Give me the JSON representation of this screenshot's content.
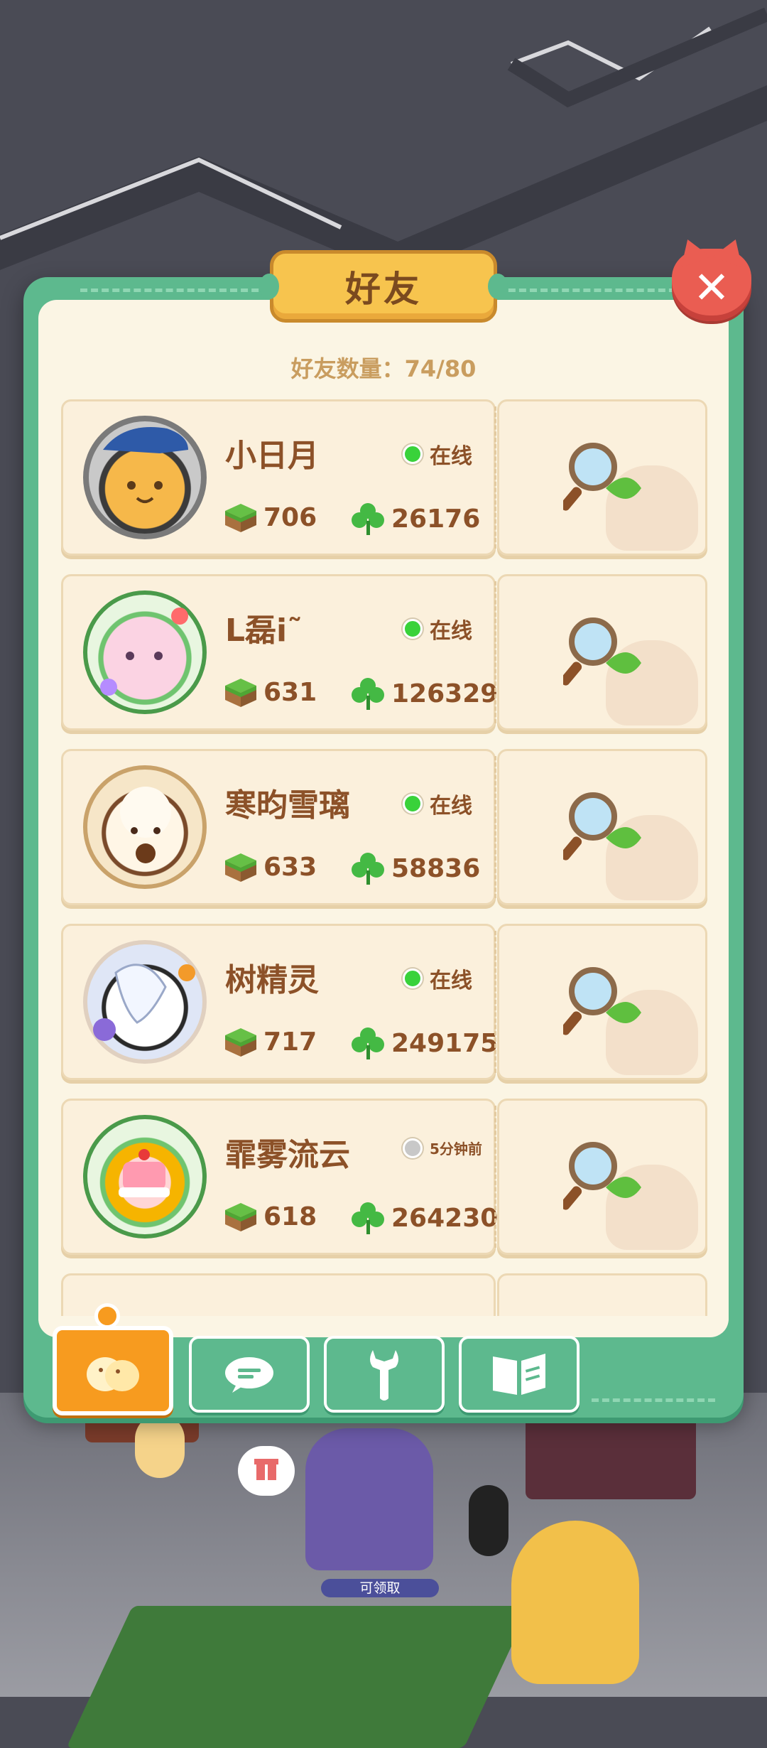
{
  "title": "好友",
  "friend_count_text": "好友数量：74/80",
  "close_label": "✕",
  "friends": [
    {
      "name": "小日月",
      "status": "在线",
      "online": true,
      "grass": "706",
      "clover": "26176"
    },
    {
      "name": "L磊i˜",
      "status": "在线",
      "online": true,
      "grass": "631",
      "clover": "126329"
    },
    {
      "name": "寒昀雪璃",
      "status": "在线",
      "online": true,
      "grass": "633",
      "clover": "58836"
    },
    {
      "name": "树精灵",
      "status": "在线",
      "online": true,
      "grass": "717",
      "clover": "249175"
    },
    {
      "name": "霏雾流云",
      "status": "5分钟前",
      "online": false,
      "grass": "618",
      "clover": "264230"
    }
  ],
  "tabs": [
    {
      "icon": "chick-icon",
      "active": true
    },
    {
      "icon": "chat-icon",
      "active": false
    },
    {
      "icon": "wrench-icon",
      "active": false
    },
    {
      "icon": "book-icon",
      "active": false
    }
  ],
  "background_badge": "可领取",
  "colors": {
    "panel_green": "#5db98e",
    "panel_cream": "#fbf5e4",
    "text_brown": "#8c5128",
    "online_green": "#39d23a",
    "close_red": "#ea5d52",
    "tab_orange": "#f79b1f"
  }
}
